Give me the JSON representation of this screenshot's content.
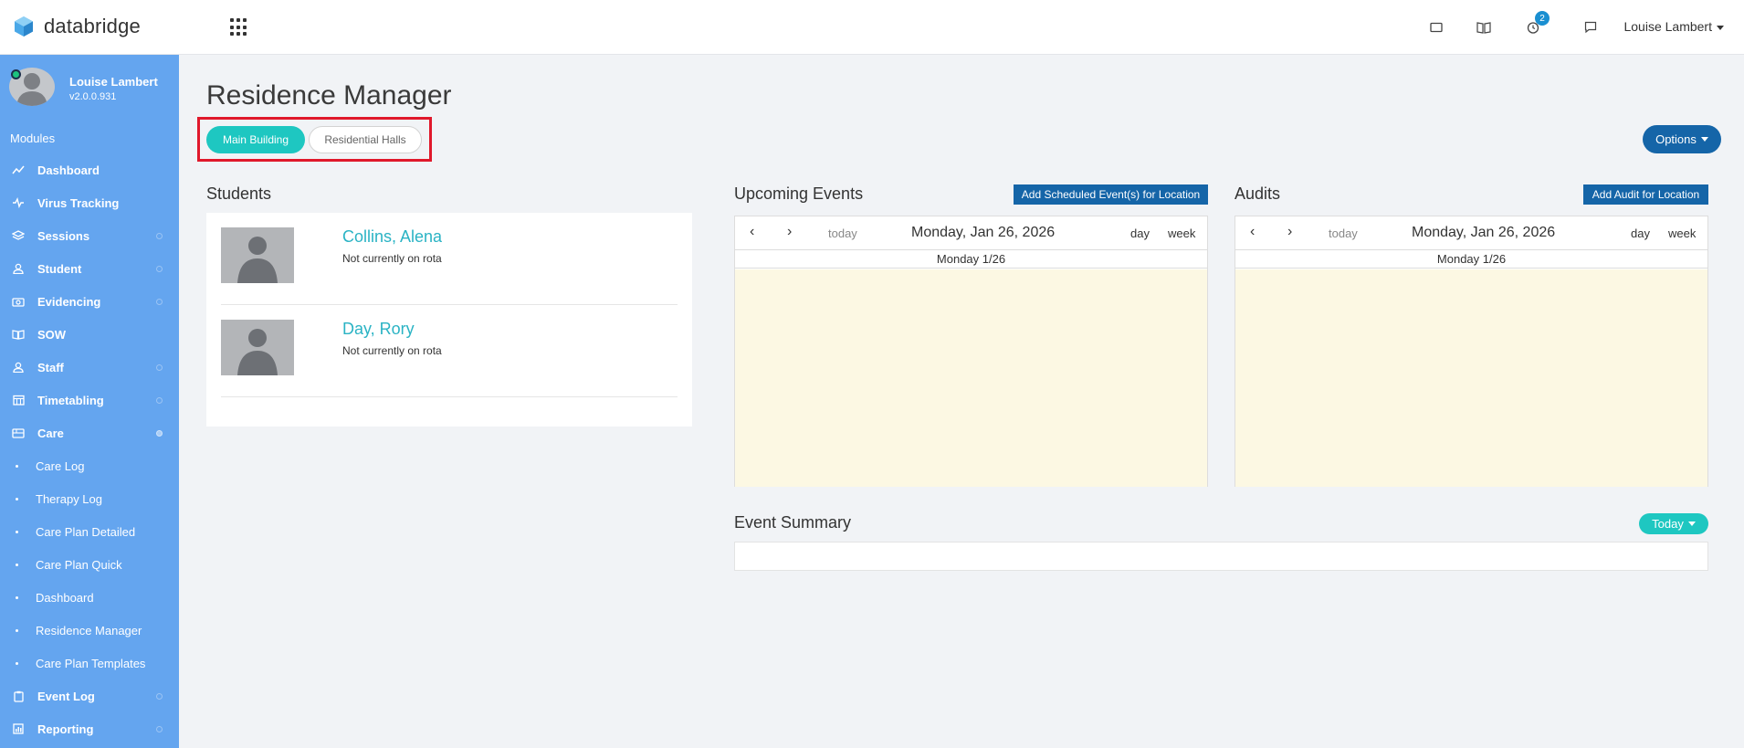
{
  "brand": {
    "name": "databridge"
  },
  "header": {
    "badge_count": "2",
    "user_name": "Louise Lambert"
  },
  "sidebar": {
    "profile_name": "Louise Lambert",
    "version": "v2.0.0.931",
    "modules_label": "Modules",
    "items": [
      {
        "label": "Dashboard",
        "icon": "chart-line-icon"
      },
      {
        "label": "Virus Tracking",
        "icon": "pulse-icon"
      },
      {
        "label": "Sessions",
        "icon": "layers-icon"
      },
      {
        "label": "Student",
        "icon": "user-icon"
      },
      {
        "label": "Evidencing",
        "icon": "camera-icon"
      },
      {
        "label": "SOW",
        "icon": "book-icon"
      },
      {
        "label": "Staff",
        "icon": "user-icon"
      },
      {
        "label": "Timetabling",
        "icon": "calendar-icon"
      },
      {
        "label": "Care",
        "icon": "care-icon"
      }
    ],
    "care_sub_items": [
      "Care Log",
      "Therapy Log",
      "Care Plan Detailed",
      "Care Plan Quick",
      "Dashboard",
      "Residence Manager",
      "Care Plan Templates"
    ],
    "items_after": [
      {
        "label": "Event Log",
        "icon": "clipboard-icon"
      },
      {
        "label": "Reporting",
        "icon": "report-icon"
      }
    ]
  },
  "page": {
    "title": "Residence Manager",
    "tabs": [
      "Main Building",
      "Residential Halls"
    ],
    "options_label": "Options"
  },
  "students": {
    "heading": "Students",
    "list": [
      {
        "name": "Collins, Alena",
        "status": "Not currently on rota"
      },
      {
        "name": "Day, Rory",
        "status": "Not currently on rota"
      }
    ]
  },
  "upcoming_events": {
    "heading": "Upcoming Events",
    "add_button": "Add Scheduled Event(s) for Location",
    "today": "today",
    "date": "Monday, Jan 26, 2026",
    "view_day": "day",
    "view_week": "week",
    "day_header": "Monday 1/26"
  },
  "audits": {
    "heading": "Audits",
    "add_button": "Add Audit for Location",
    "today": "today",
    "date": "Monday, Jan 26, 2026",
    "view_day": "day",
    "view_week": "week",
    "day_header": "Monday 1/26"
  },
  "event_summary": {
    "heading": "Event Summary",
    "filter_label": "Today"
  },
  "colors": {
    "sidebar": "#64a5ef",
    "accent_teal": "#1ec7c1",
    "primary_blue": "#1565a8",
    "highlight_red": "#e0182b",
    "calendar_bg": "#fcf8e3"
  }
}
